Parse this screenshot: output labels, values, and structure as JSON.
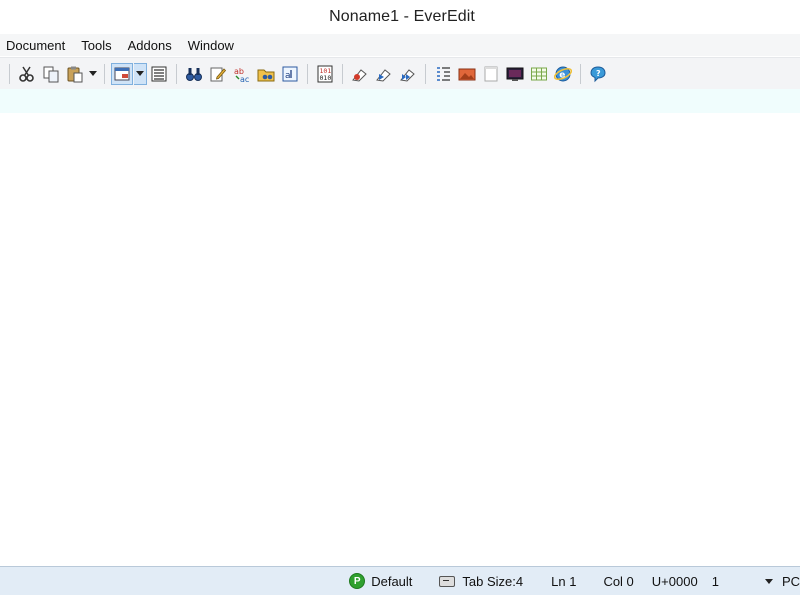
{
  "window": {
    "title": "Noname1 - EverEdit"
  },
  "menu": {
    "items": [
      "Document",
      "Tools",
      "Addons",
      "Window"
    ]
  },
  "toolbar": {
    "icons": [
      "cut-icon",
      "copy-icon",
      "paste-icon",
      "paste-dropdown",
      "view-mode-icon",
      "view-mode-dropdown",
      "document-list-icon",
      "find-icon",
      "edit-note-icon",
      "replace-icon",
      "find-in-files-icon",
      "goto-icon",
      "hex-view-icon",
      "macro-record-icon",
      "macro-play-icon",
      "macro-run-multiple-icon",
      "outline-icon",
      "image-icon",
      "blank-page-icon",
      "monitor-icon",
      "grid-icon",
      "browser-icon",
      "help-icon"
    ]
  },
  "statusbar": {
    "encoding_icon_letter": "P",
    "encoding": "Default",
    "tab_size": "Tab Size:4",
    "line": "Ln 1",
    "column": "Col 0",
    "unicode": "U+0000",
    "selection": "1",
    "line_ending": "PC"
  },
  "colors": {
    "ruler_bg": "#f0fdfd",
    "statusbar_bg": "#e2ecf6",
    "active_button_bg": "#cfe3f7"
  }
}
